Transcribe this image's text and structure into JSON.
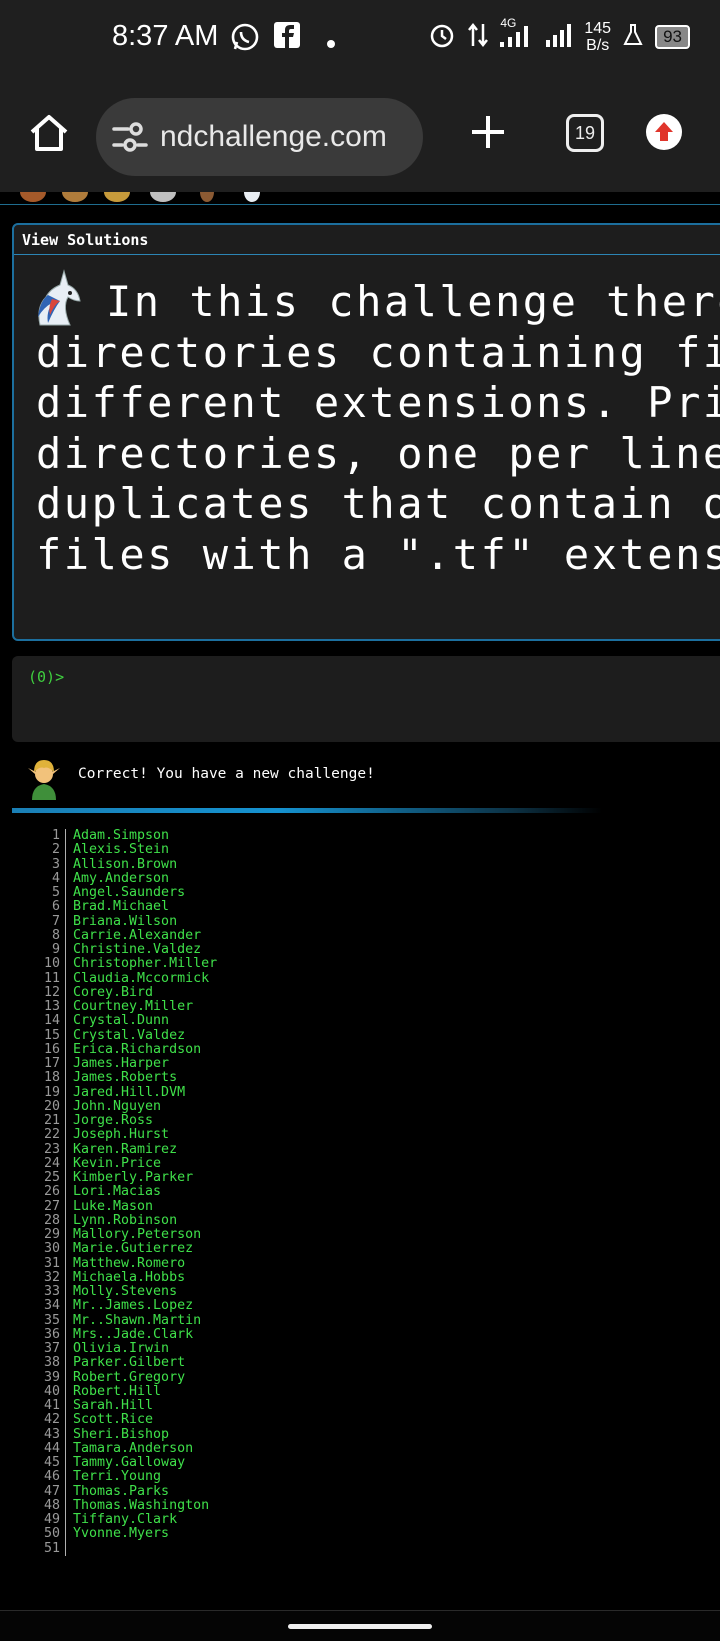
{
  "status_bar": {
    "time": "8:37 AM",
    "network": "4G",
    "net_speed_value": "145",
    "net_speed_unit": "B/s",
    "battery": "93",
    "icons": [
      "whatsapp-icon",
      "facebook-icon",
      "dot-icon",
      "alarm-icon",
      "data-arrows-icon",
      "signal-icon",
      "signal-icon-2",
      "lab-icon",
      "battery-icon"
    ]
  },
  "browser": {
    "url": "ndchallenge.com",
    "tab_count": "19"
  },
  "panel": {
    "header": "View Solutions",
    "prompt_lines": [
      "In this challenge there",
      "directories containing file",
      "different extensions. Print",
      "directories, one per line w",
      "duplicates that contain one",
      "files with a \".tf\" extensio"
    ]
  },
  "terminal": {
    "prompt": "(0)>"
  },
  "feedback": {
    "message": "Correct! You have a new challenge!"
  },
  "output": {
    "lines": [
      {
        "n": "1",
        "text": "Adam.Simpson"
      },
      {
        "n": "2",
        "text": "Alexis.Stein"
      },
      {
        "n": "3",
        "text": "Allison.Brown"
      },
      {
        "n": "4",
        "text": "Amy.Anderson"
      },
      {
        "n": "5",
        "text": "Angel.Saunders"
      },
      {
        "n": "6",
        "text": "Brad.Michael"
      },
      {
        "n": "7",
        "text": "Briana.Wilson"
      },
      {
        "n": "8",
        "text": "Carrie.Alexander"
      },
      {
        "n": "9",
        "text": "Christine.Valdez"
      },
      {
        "n": "10",
        "text": "Christopher.Miller"
      },
      {
        "n": "11",
        "text": "Claudia.Mccormick"
      },
      {
        "n": "12",
        "text": "Corey.Bird"
      },
      {
        "n": "13",
        "text": "Courtney.Miller"
      },
      {
        "n": "14",
        "text": "Crystal.Dunn"
      },
      {
        "n": "15",
        "text": "Crystal.Valdez"
      },
      {
        "n": "16",
        "text": "Erica.Richardson"
      },
      {
        "n": "17",
        "text": "James.Harper"
      },
      {
        "n": "18",
        "text": "James.Roberts"
      },
      {
        "n": "19",
        "text": "Jared.Hill.DVM"
      },
      {
        "n": "20",
        "text": "John.Nguyen"
      },
      {
        "n": "21",
        "text": "Jorge.Ross"
      },
      {
        "n": "22",
        "text": "Joseph.Hurst"
      },
      {
        "n": "23",
        "text": "Karen.Ramirez"
      },
      {
        "n": "24",
        "text": "Kevin.Price"
      },
      {
        "n": "25",
        "text": "Kimberly.Parker"
      },
      {
        "n": "26",
        "text": "Lori.Macias"
      },
      {
        "n": "27",
        "text": "Luke.Mason"
      },
      {
        "n": "28",
        "text": "Lynn.Robinson"
      },
      {
        "n": "29",
        "text": "Mallory.Peterson"
      },
      {
        "n": "30",
        "text": "Marie.Gutierrez"
      },
      {
        "n": "31",
        "text": "Matthew.Romero"
      },
      {
        "n": "32",
        "text": "Michaela.Hobbs"
      },
      {
        "n": "33",
        "text": "Molly.Stevens"
      },
      {
        "n": "34",
        "text": "Mr..James.Lopez"
      },
      {
        "n": "35",
        "text": "Mr..Shawn.Martin"
      },
      {
        "n": "36",
        "text": "Mrs..Jade.Clark"
      },
      {
        "n": "37",
        "text": "Olivia.Irwin"
      },
      {
        "n": "38",
        "text": "Parker.Gilbert"
      },
      {
        "n": "39",
        "text": "Robert.Gregory"
      },
      {
        "n": "40",
        "text": "Robert.Hill"
      },
      {
        "n": "41",
        "text": "Sarah.Hill"
      },
      {
        "n": "42",
        "text": "Scott.Rice"
      },
      {
        "n": "43",
        "text": "Sheri.Bishop"
      },
      {
        "n": "44",
        "text": "Tamara.Anderson"
      },
      {
        "n": "45",
        "text": "Tammy.Galloway"
      },
      {
        "n": "46",
        "text": "Terri.Young"
      },
      {
        "n": "47",
        "text": "Thomas.Parks"
      },
      {
        "n": "48",
        "text": "Thomas.Washington"
      },
      {
        "n": "49",
        "text": "Tiffany.Clark"
      },
      {
        "n": "50",
        "text": "Yvonne.Myers"
      },
      {
        "n": "51",
        "text": ""
      }
    ]
  },
  "colors": {
    "accent": "#1c6f9e",
    "output_text": "#3fe04a",
    "panel_bg": "#1d1d1d",
    "chrome_bg": "#1f1f1f"
  }
}
